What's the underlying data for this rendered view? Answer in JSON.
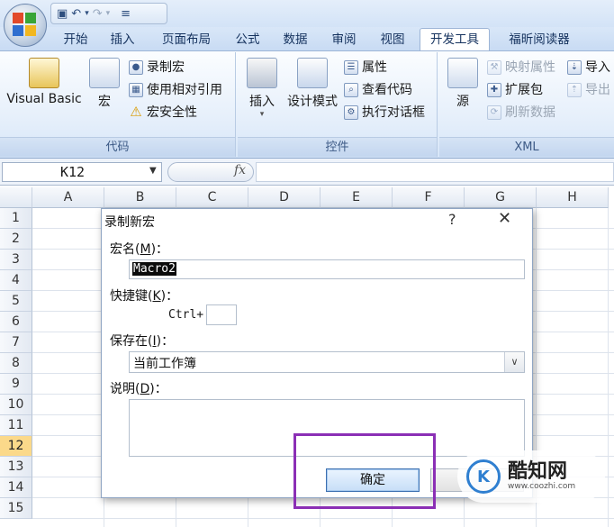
{
  "title_bar": {
    "qat_icons": [
      "save-icon",
      "undo-icon",
      "redo-icon",
      "customize-icon"
    ]
  },
  "tabs": [
    {
      "label": "开始"
    },
    {
      "label": "插入"
    },
    {
      "label": "页面布局"
    },
    {
      "label": "公式"
    },
    {
      "label": "数据"
    },
    {
      "label": "审阅"
    },
    {
      "label": "视图"
    },
    {
      "label": "开发工具",
      "active": true
    },
    {
      "label": "福昕阅读器"
    }
  ],
  "ribbon": {
    "code_group": {
      "label": "代码",
      "visual_basic": "Visual Basic",
      "macros": "宏",
      "record_macro": "录制宏",
      "relative_refs": "使用相对引用",
      "macro_security": "宏安全性"
    },
    "controls_group": {
      "label": "控件",
      "insert": "插入",
      "design_mode": "设计模式",
      "properties": "属性",
      "view_code": "查看代码",
      "run_dialog": "执行对话框"
    },
    "xml_group": {
      "label": "XML",
      "source": "源",
      "map_properties": "映射属性",
      "expansion_packs": "扩展包",
      "refresh_data": "刷新数据",
      "import": "导入",
      "export": "导出"
    }
  },
  "formula_bar": {
    "name_box": "K12",
    "fx": "fx",
    "formula": ""
  },
  "grid": {
    "columns": [
      "A",
      "B",
      "C",
      "D",
      "E",
      "F",
      "G",
      "H"
    ],
    "rows": [
      "1",
      "2",
      "3",
      "4",
      "5",
      "6",
      "7",
      "8",
      "9",
      "10",
      "11",
      "12",
      "13",
      "14",
      "15"
    ],
    "active_row": "12"
  },
  "dialog": {
    "title": "录制新宏",
    "help": "?",
    "close": "✕",
    "macro_name_label": "宏名(",
    "macro_name_key": "M",
    "macro_name_label_end": ")：",
    "macro_name_value": "Macro2",
    "shortcut_label": "快捷键(",
    "shortcut_key": "K",
    "shortcut_label_end": ")：",
    "ctrl_prefix": "Ctrl+",
    "shortcut_value": "",
    "store_label": "保存在(",
    "store_key": "I",
    "store_label_end": ")：",
    "store_value": "当前工作簿",
    "desc_label": "说明(",
    "desc_key": "D",
    "desc_label_end": ")：",
    "description": "",
    "ok_label": "确定"
  },
  "watermark": {
    "logo": "K",
    "name": "酷知网",
    "url": "www.coozhi.com"
  },
  "colors": {
    "highlight": "#8b2fb5",
    "ribbon_blue": "#c8dbf3",
    "active_row": "#fbd98a"
  }
}
